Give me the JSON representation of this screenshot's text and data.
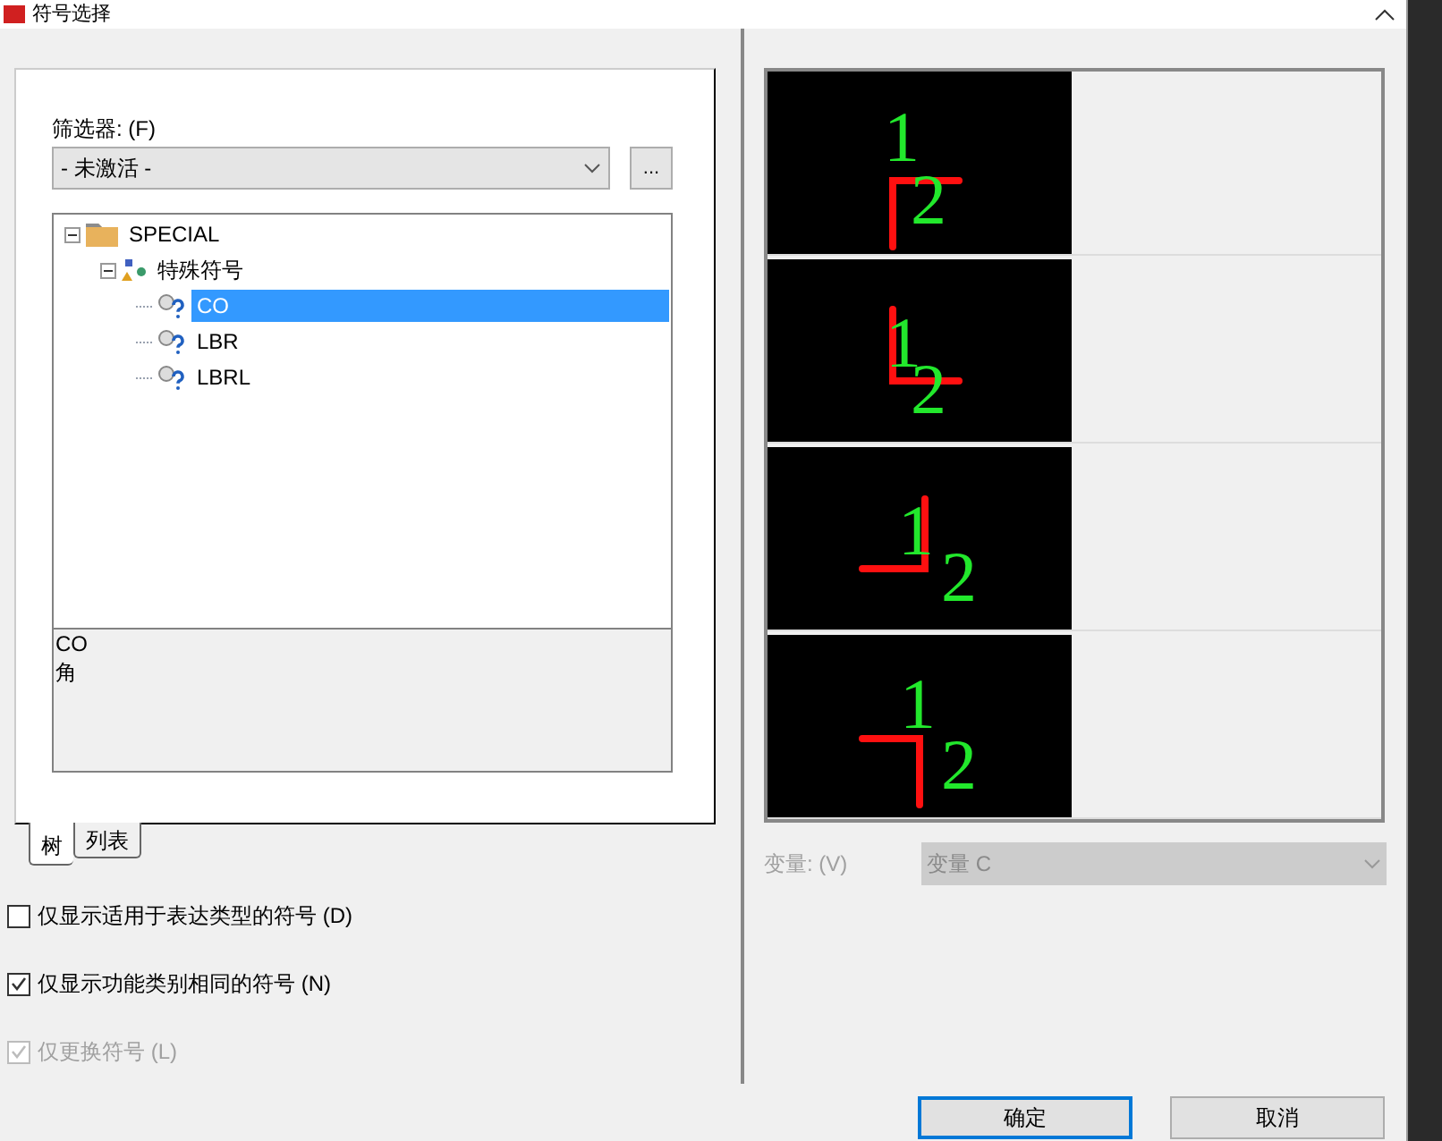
{
  "window": {
    "title": "符号选择"
  },
  "filter": {
    "label": "筛选器: (F)",
    "value": "- 未激活 -",
    "browse": "..."
  },
  "tree": [
    {
      "label": "SPECIAL",
      "kind": "folder",
      "expanded": true,
      "selected": false,
      "children": [
        {
          "label": "特殊符号",
          "kind": "group",
          "expanded": true,
          "selected": false,
          "children": [
            {
              "label": "CO",
              "kind": "symbol",
              "selected": true
            },
            {
              "label": "LBR",
              "kind": "symbol",
              "selected": false
            },
            {
              "label": "LBRL",
              "kind": "symbol",
              "selected": false
            }
          ]
        }
      ]
    }
  ],
  "description": [
    "CO",
    "角"
  ],
  "tabs": [
    {
      "label": "树",
      "selected": true
    },
    {
      "label": "列表",
      "selected": false
    }
  ],
  "checkboxes": [
    {
      "label": "仅显示适用于表达类型的符号 (D)",
      "checked": false,
      "disabled": false
    },
    {
      "label": "仅显示功能类别相同的符号 (N)",
      "checked": true,
      "disabled": false
    },
    {
      "label": "仅更换符号 (L)",
      "checked": true,
      "disabled": true
    }
  ],
  "previews": [
    {
      "kind": "top-left",
      "pin_1": "1",
      "pin_2": "2"
    },
    {
      "kind": "bottom-left",
      "pin_1": "1",
      "pin_2": "2"
    },
    {
      "kind": "bottom-right",
      "pin_1": "1",
      "pin_2": "2"
    },
    {
      "kind": "top-right",
      "pin_1": "1",
      "pin_2": "2"
    }
  ],
  "variant": {
    "label": "变量: (V)",
    "value": "变量 C",
    "disabled": true
  },
  "buttons": [
    "确定",
    "取消"
  ]
}
